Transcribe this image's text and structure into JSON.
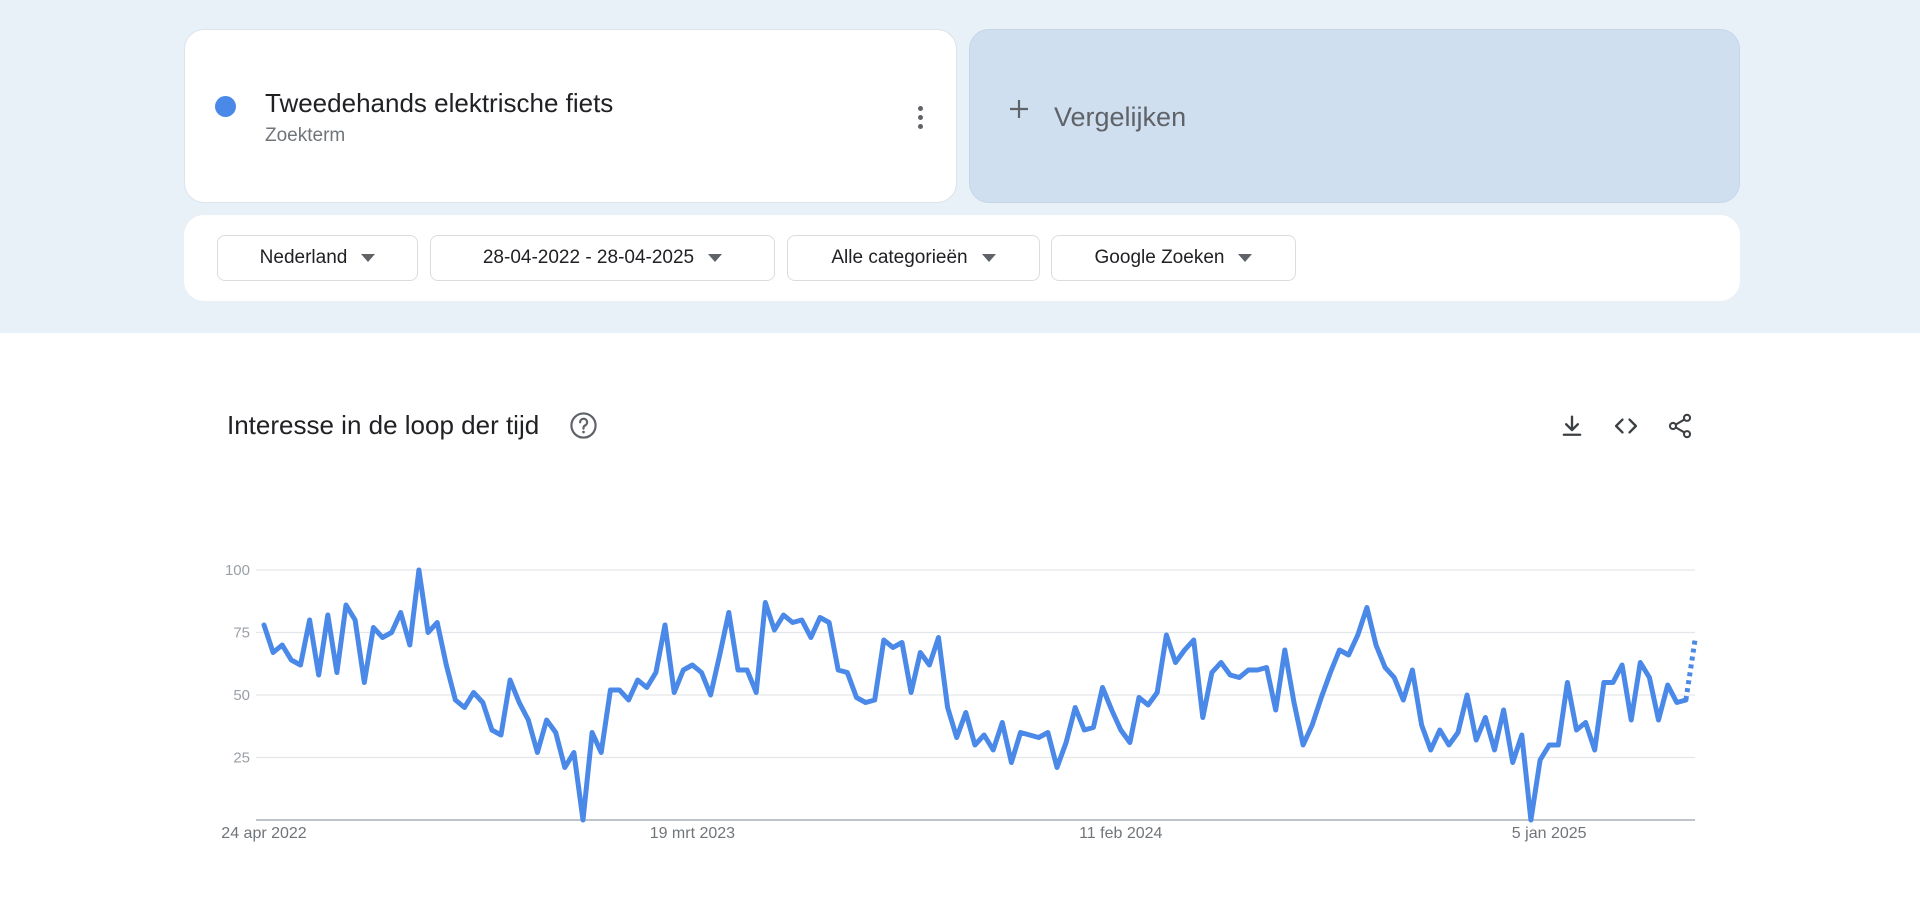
{
  "search_term": {
    "title": "Tweedehands elektrische fiets",
    "subtitle": "Zoekterm",
    "color": "#4a89e8",
    "more_icon": "more-vert-icon"
  },
  "compare": {
    "label": "Vergelijken",
    "icon": "plus-icon"
  },
  "filters": [
    {
      "label": "Nederland"
    },
    {
      "label": "28-04-2022 - 28-04-2025"
    },
    {
      "label": "Alle categorieën"
    },
    {
      "label": "Google Zoeken"
    }
  ],
  "section": {
    "title": "Interesse in de loop der tijd",
    "help_icon": "help-icon",
    "tools": [
      "download-icon",
      "embed-code-icon",
      "share-icon"
    ]
  },
  "chart_data": {
    "type": "line",
    "title": "",
    "xlabel": "",
    "ylabel": "",
    "ylim": [
      0,
      100
    ],
    "yticks": [
      25,
      50,
      75,
      100
    ],
    "xtick_labels": [
      {
        "label": "24 apr 2022",
        "index": 0
      },
      {
        "label": "19 mrt 2023",
        "index": 47
      },
      {
        "label": "11 feb 2024",
        "index": 94
      },
      {
        "label": "5 jan 2025",
        "index": 141
      }
    ],
    "grid": true,
    "legend": "none",
    "partial_last_point": true,
    "series": [
      {
        "color": "#4a89e8",
        "values": [
          78,
          67,
          70,
          64,
          62,
          80,
          58,
          82,
          59,
          86,
          80,
          55,
          77,
          73,
          75,
          83,
          70,
          100,
          75,
          79,
          62,
          48,
          45,
          51,
          47,
          36,
          34,
          56,
          47,
          40,
          27,
          40,
          35,
          21,
          27,
          0,
          35,
          27,
          52,
          52,
          48,
          56,
          53,
          59,
          78,
          51,
          60,
          62,
          59,
          50,
          66,
          83,
          60,
          60,
          51,
          87,
          76,
          82,
          79,
          80,
          73,
          81,
          79,
          60,
          59,
          49,
          47,
          48,
          72,
          69,
          71,
          51,
          67,
          62,
          73,
          45,
          33,
          43,
          30,
          34,
          28,
          39,
          23,
          35,
          34,
          33,
          35,
          21,
          31,
          45,
          36,
          37,
          53,
          44,
          36,
          31,
          49,
          46,
          51,
          74,
          63,
          68,
          72,
          41,
          59,
          63,
          58,
          57,
          60,
          60,
          61,
          44,
          68,
          47,
          30,
          38,
          49,
          59,
          68,
          66,
          74,
          85,
          70,
          61,
          57,
          48,
          60,
          38,
          28,
          36,
          30,
          35,
          50,
          32,
          41,
          28,
          44,
          23,
          34,
          0,
          24,
          30,
          30,
          55,
          36,
          39,
          28,
          55,
          55,
          62,
          40,
          63,
          57,
          40,
          54,
          47,
          48,
          72
        ]
      }
    ]
  }
}
